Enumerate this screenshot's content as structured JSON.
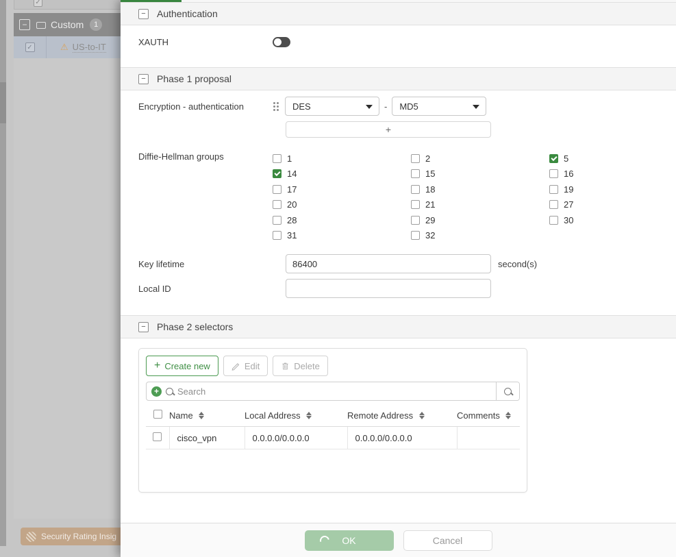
{
  "background": {
    "tree_group": {
      "label": "Custom",
      "count": "1",
      "collapse_icon": "minus-icon",
      "device_icon": "laptop-icon"
    },
    "tree_item": {
      "label": "US-to-IT",
      "warning_icon": "warning-triangle-icon"
    },
    "status_pill": {
      "label": "Security Rating Insig",
      "icon": "security-rating-icon"
    }
  },
  "modal": {
    "progress_percent": 11,
    "sections": {
      "authentication": {
        "title": "Authentication",
        "collapse_icon": "minus-icon",
        "xauth": {
          "label": "XAUTH",
          "value": "off"
        }
      },
      "phase1": {
        "title": "Phase 1 proposal",
        "collapse_icon": "minus-icon",
        "encryption_row": {
          "label": "Encryption - authentication",
          "drag_icon": "drag-handle-icon",
          "encryption": "DES",
          "separator": "-",
          "authentication": "MD5",
          "add_label": "+"
        },
        "dh": {
          "label": "Diffie-Hellman groups",
          "columns": [
            [
              {
                "value": "1",
                "checked": false
              },
              {
                "value": "14",
                "checked": true
              },
              {
                "value": "17",
                "checked": false
              },
              {
                "value": "20",
                "checked": false
              },
              {
                "value": "28",
                "checked": false
              },
              {
                "value": "31",
                "checked": false
              }
            ],
            [
              {
                "value": "2",
                "checked": false
              },
              {
                "value": "15",
                "checked": false
              },
              {
                "value": "18",
                "checked": false
              },
              {
                "value": "21",
                "checked": false
              },
              {
                "value": "29",
                "checked": false
              },
              {
                "value": "32",
                "checked": false
              }
            ],
            [
              {
                "value": "5",
                "checked": true
              },
              {
                "value": "16",
                "checked": false
              },
              {
                "value": "19",
                "checked": false
              },
              {
                "value": "27",
                "checked": false
              },
              {
                "value": "30",
                "checked": false
              }
            ]
          ]
        },
        "key_lifetime": {
          "label": "Key lifetime",
          "value": "86400",
          "unit": "second(s)"
        },
        "local_id": {
          "label": "Local ID",
          "value": "",
          "placeholder": ""
        }
      },
      "phase2": {
        "title": "Phase 2 selectors",
        "collapse_icon": "minus-icon",
        "toolbar": {
          "create_new": {
            "label": "Create new",
            "icon": "plus-icon",
            "enabled": true
          },
          "edit": {
            "label": "Edit",
            "icon": "pencil-icon",
            "enabled": false
          },
          "delete": {
            "label": "Delete",
            "icon": "trash-icon",
            "enabled": false
          }
        },
        "search": {
          "placeholder": "Search",
          "value": "",
          "add_icon": "add-circle-icon",
          "icon": "search-icon",
          "button_icon": "search-icon"
        },
        "table": {
          "columns": [
            "Name",
            "Local Address",
            "Remote Address",
            "Comments"
          ],
          "rows": [
            {
              "selected": false,
              "name": "cisco_vpn",
              "local_address": "0.0.0.0/0.0.0.0",
              "remote_address": "0.0.0.0/0.0.0.0",
              "comments": ""
            }
          ]
        }
      }
    },
    "footer": {
      "ok": {
        "label": "OK",
        "state": "loading"
      },
      "cancel": {
        "label": "Cancel"
      }
    }
  },
  "colors": {
    "accent_green": "#38853f",
    "checkbox_green": "#3a8a3f",
    "ok_disabled": "#a5cba8"
  }
}
